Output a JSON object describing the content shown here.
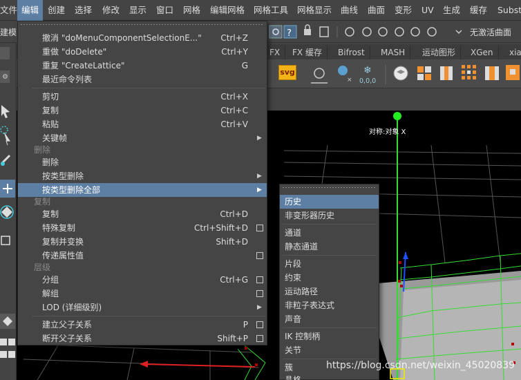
{
  "menubar": {
    "items": [
      "文件",
      "编辑",
      "创建",
      "选择",
      "修改",
      "显示",
      "窗口",
      "网格",
      "编辑网格",
      "网格工具",
      "网格显示",
      "曲线",
      "曲面",
      "变形",
      "UV",
      "生成",
      "缓存",
      "Subst"
    ]
  },
  "statusline": {
    "mode_label": "建模",
    "live_surface": "无激活曲面"
  },
  "shelf": {
    "tabs": [
      "FX",
      "FX 缓存",
      "Bifrost",
      "MASH",
      "运动图形",
      "XGen",
      "xia"
    ],
    "svg_button": "svg",
    "value_readout": "0,0,0"
  },
  "viewport": {
    "label": "对称:对象 X",
    "watermark": "https://blog.csdn.net/weixin_45020839"
  },
  "edit_menu": {
    "items": [
      {
        "label": "撤消 \"doMenuComponentSelectionE...\"",
        "shortcut": "Ctrl+Z"
      },
      {
        "label": "重做 \"doDelete\"",
        "shortcut": "Ctrl+Y"
      },
      {
        "label": "重复 \"CreateLattice\"",
        "shortcut": "G"
      },
      {
        "label": "最近命令列表",
        "shortcut": ""
      },
      {
        "label": "剪切",
        "shortcut": "Ctrl+X"
      },
      {
        "label": "复制",
        "shortcut": "Ctrl+C"
      },
      {
        "label": "粘贴",
        "shortcut": "Ctrl+V"
      },
      {
        "label": "关键帧",
        "shortcut": ""
      },
      {
        "label": "删除",
        "shortcut": ""
      },
      {
        "label": "按类型删除",
        "shortcut": ""
      },
      {
        "label": "按类型删除全部",
        "shortcut": ""
      },
      {
        "label": "复制",
        "shortcut": "Ctrl+D"
      },
      {
        "label": "特殊复制",
        "shortcut": "Ctrl+Shift+D"
      },
      {
        "label": "复制并变换",
        "shortcut": "Shift+D"
      },
      {
        "label": "传递属性值",
        "shortcut": ""
      },
      {
        "label": "分组",
        "shortcut": "Ctrl+G"
      },
      {
        "label": "解组",
        "shortcut": ""
      },
      {
        "label": "LOD (详细级别)",
        "shortcut": ""
      },
      {
        "label": "建立父子关系",
        "shortcut": "P"
      },
      {
        "label": "断开父子关系",
        "shortcut": "Shift+P"
      }
    ],
    "sections": [
      "删除",
      "复制",
      "层级"
    ]
  },
  "submenu": {
    "items": [
      "历史",
      "非变形器历史",
      "通道",
      "静态通道",
      "片段",
      "约束",
      "运动路径",
      "非粒子表达式",
      "声音",
      "IK 控制柄",
      "关节",
      "簇",
      "晶格"
    ]
  },
  "colors": {
    "highlight": "#5d7fa3",
    "menu_bg": "#454545",
    "app_bg": "#444444"
  }
}
